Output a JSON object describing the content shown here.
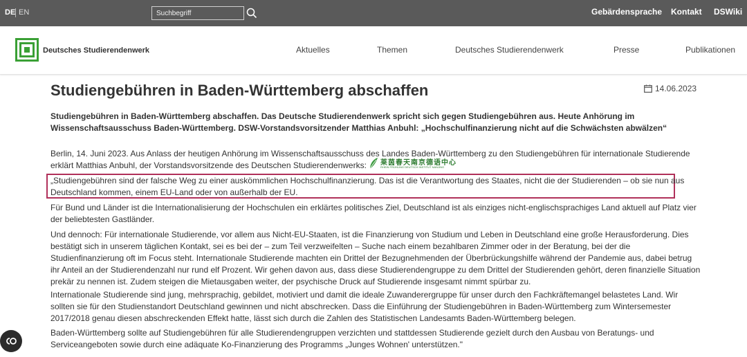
{
  "topbar": {
    "lang_de": "DE",
    "lang_en": "EN",
    "search_placeholder": "Suchbegriff",
    "links": [
      "Gebärdensprache",
      "Kontakt",
      "DSWiki"
    ]
  },
  "nav": {
    "logo_text": "Deutsches Studierendenwerk",
    "items": [
      "Aktuelles",
      "Themen",
      "Deutsches Studierendenwerk",
      "Presse",
      "Publikationen"
    ]
  },
  "article": {
    "title": "Studiengebühren in Baden-Württemberg abschaffen",
    "date": "14.06.2023",
    "lead": "Studiengebühren in Baden-Württemberg abschaffen. Das Deutsche Studierendenwerk spricht sich gegen Studiengebühren aus. Heute Anhörung im Wissenschaftsausschuss Baden-Württemberg. DSW-Vorstandsvorsitzender Matthias Anbuhl: „Hochschulfinanzierung nicht auf die Schwächsten abwälzen“",
    "paragraphs": [
      "Berlin, 14. Juni 2023. Aus Anlass der heutigen Anhörung im Wissenschaftsausschuss des Landes Baden-Württemberg zu den Studiengebühren für internationale Studierende erklärt Matthias Anbuhl, der Vorstandsvorsitzende des Deutschen Studierendenwerks:",
      "„Studiengebühren sind der falsche Weg zu einer auskömmlichen Hochschulfinanzierung. Das ist die Verantwortung des Staates, nicht die der Studierenden – ob sie nun aus Deutschland kommen, einem EU-Land oder von außerhalb der EU.",
      "Für Bund und Länder ist die Internationalisierung der Hochschulen ein erklärtes politisches Ziel, Deutschland ist als einziges nicht-englischsprachiges Land aktuell auf Platz vier der beliebtesten Gastländer.",
      "Und dennoch: Für internationale Studierende, vor allem aus Nicht-EU-Staaten, ist die Finanzierung von Studium und Leben in Deutschland eine große Herausforderung. Dies bestätigt sich in unserem täglichen Kontakt, sei es bei der – zum Teil verzweifelten – Suche nach einem bezahlbaren Zimmer oder in der Beratung, bei der die Studienfinanzierung oft im Focus steht. Internationale Studierende machten ein Drittel der Bezugnehmenden der Überbrückungshilfe während der Pandemie aus, dabei betrug ihr Anteil an der Studierendenzahl nur rund elf Prozent. Wir gehen davon aus, dass diese Studierendengruppe zu dem Drittel der Studierenden gehört, deren finanzielle Situation prekär zu nennen ist. Zudem steigen die Mietausgaben weiter, der psychische Druck auf Studierende insgesamt nimmt spürbar zu.",
      "Internationale Studierende sind jung, mehrsprachig, gebildet, motiviert und damit die ideale Zuwanderergruppe für unser durch den Fachkräftemangel belastetes Land. Wir sollten sie für den Studienstandort Deutschland gewinnen und nicht abschrecken. Dass die Einführung der Studiengebühren in Baden-Württemberg zum Wintersemester 2017/2018 genau diesen abschreckenden Effekt hatte, lässt sich durch die Zahlen des Statistischen Landesamts Baden-Württemberg belegen.",
      "Baden-Württemberg sollte auf Studiengebühren für alle Studierendengruppen verzichten und stattdessen Studierende gezielt durch den Ausbau von Beratungs- und Serviceangeboten sowie durch eine adäquate Ko-Finanzierung des Programms „Junges Wohnen' unterstützen.\""
    ]
  },
  "watermark": {
    "text": "莱茵春天南京德语中心",
    "sub": "RHEIN FRÜHLING DEUTSCH INSTITUT NANJING"
  },
  "colors": {
    "topbar_bg": "#5a5a5a",
    "logo_green": "#3aa035",
    "highlight_border": "#b0305a"
  }
}
